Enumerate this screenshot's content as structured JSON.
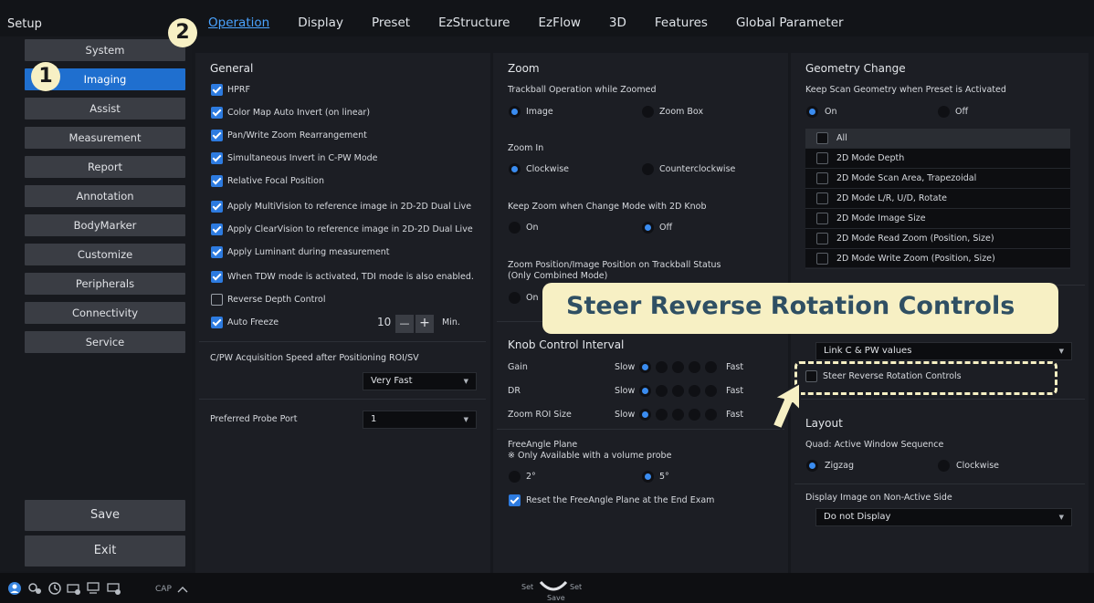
{
  "app_title": "Setup",
  "tabs": [
    "Operation",
    "Display",
    "Preset",
    "EzStructure",
    "EzFlow",
    "3D",
    "Features",
    "Global Parameter"
  ],
  "sidebar": {
    "items": [
      "System",
      "Imaging",
      "Assist",
      "Measurement",
      "Report",
      "Annotation",
      "BodyMarker",
      "Customize",
      "Peripherals",
      "Connectivity",
      "Service"
    ],
    "save": "Save",
    "exit": "Exit"
  },
  "general": {
    "title": "General",
    "options": [
      {
        "label": "HPRF",
        "checked": true
      },
      {
        "label": "Color Map Auto Invert (on linear)",
        "checked": true
      },
      {
        "label": "Pan/Write Zoom Rearrangement",
        "checked": true
      },
      {
        "label": "Simultaneous Invert in C-PW Mode",
        "checked": true
      },
      {
        "label": "Relative Focal Position",
        "checked": true
      },
      {
        "label": "Apply MultiVision to reference image in 2D-2D Dual Live",
        "checked": true
      },
      {
        "label": "Apply ClearVision to reference image in 2D-2D Dual Live",
        "checked": true
      },
      {
        "label": "Apply Luminant during measurement",
        "checked": true
      },
      {
        "label": "When TDW mode is activated, TDI mode is also enabled.",
        "checked": true
      },
      {
        "label": "Reverse Depth Control",
        "checked": false
      },
      {
        "label": "Auto Freeze",
        "checked": true
      }
    ],
    "auto_freeze_value": "10",
    "auto_freeze_minus": "—",
    "auto_freeze_plus": "+",
    "auto_freeze_unit": "Min.",
    "acq_speed_label": "C/PW Acquisition Speed after Positioning ROI/SV",
    "acq_speed_value": "Very Fast",
    "probe_port_label": "Preferred Probe Port",
    "probe_port_value": "1"
  },
  "zoom": {
    "title": "Zoom",
    "trackball_label": "Trackball Operation while Zoomed",
    "trackball_opt1": "Image",
    "trackball_opt2": "Zoom Box",
    "zoomin_label": "Zoom In",
    "zoomin_opt1": "Clockwise",
    "zoomin_opt2": "Counterclockwise",
    "keepzoom_label": "Keep Zoom when Change Mode with 2D Knob",
    "keepzoom_opt1": "On",
    "keepzoom_opt2": "Off",
    "zoompos_label1": "Zoom Position/Image Position on Trackball Status",
    "zoompos_label2": "(Only Combined Mode)",
    "zoompos_opt1": "On"
  },
  "knob": {
    "title": "Knob Control Interval",
    "slow": "Slow",
    "fast": "Fast",
    "rows": [
      "Gain",
      "DR",
      "Zoom ROI Size"
    ],
    "freeangle_label": "FreeAngle Plane",
    "freeangle_note": "※ Only Available with a volume probe",
    "freeangle_opt1": "2°",
    "freeangle_opt2": "5°",
    "reset_label": "Reset the FreeAngle Plane at the End Exam"
  },
  "geometry": {
    "title": "Geometry Change",
    "keep_label": "Keep Scan Geometry when Preset is Activated",
    "opt_on": "On",
    "opt_off": "Off",
    "items": [
      "All",
      "2D Mode Depth",
      "2D Mode Scan Area, Trapezoidal",
      "2D Mode L/R, U/D, Rotate",
      "2D Mode Image Size",
      "2D Mode Read Zoom (Position, Size)",
      "2D Mode Write Zoom (Position, Size)"
    ],
    "link_value": "Link C & PW values",
    "steer_label": "Steer Reverse Rotation Controls"
  },
  "layout": {
    "title": "Layout",
    "quad_label": "Quad: Active Window Sequence",
    "quad_opt1": "Zigzag",
    "quad_opt2": "Clockwise",
    "display_label": "Display Image on Non-Active Side",
    "display_value": "Do not Display"
  },
  "callout": {
    "text": "Steer Reverse Rotation Controls"
  },
  "badges": {
    "one": "1",
    "two": "2"
  },
  "bottombar": {
    "cap": "CAP",
    "set_left": "Set",
    "set_right": "Set",
    "save": "Save"
  },
  "colors": {
    "accent": "#1f6fcf",
    "link": "#4aa3ff",
    "callout_bg": "#f7f0c4",
    "callout_text": "#2f4f63"
  }
}
